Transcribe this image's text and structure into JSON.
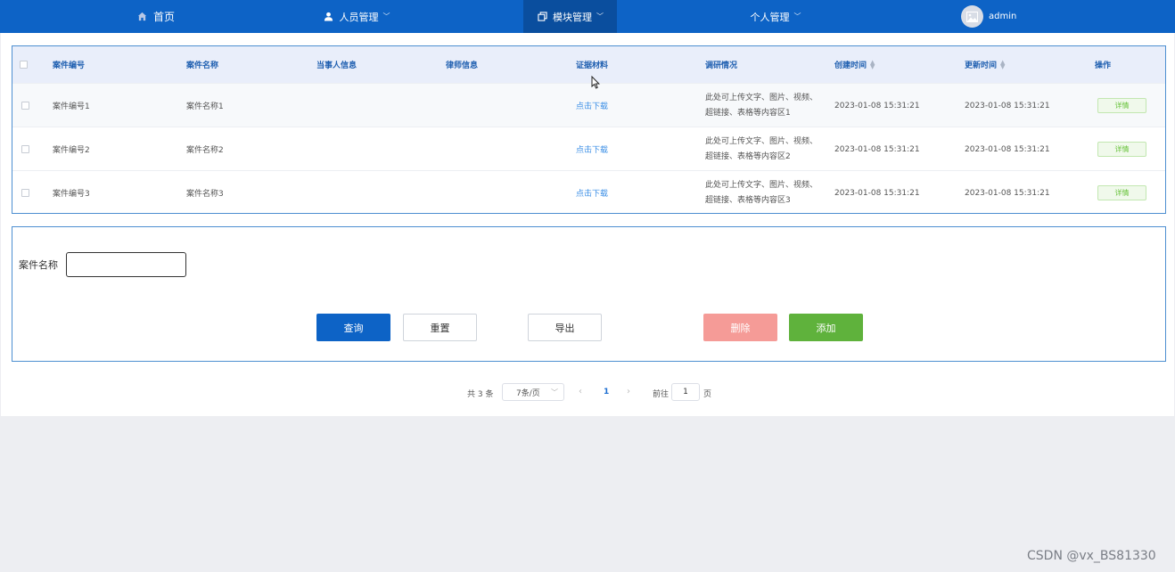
{
  "nav": {
    "home": "首页",
    "staff": "人员管理",
    "module": "模块管理",
    "personal": "个人管理",
    "user": "admin",
    "accent": "#0d63c6"
  },
  "table": {
    "headers": {
      "case_no": "案件编号",
      "case_name": "案件名称",
      "party": "当事人信息",
      "lawyer": "律师信息",
      "evidence": "证据材料",
      "research": "调研情况",
      "created": "创建时间",
      "updated": "更新时间",
      "ops": "操作"
    },
    "rows": [
      {
        "case_no": "案件编号1",
        "case_name": "案件名称1",
        "party": "",
        "lawyer": "",
        "evidence": "点击下载",
        "research": "此处可上传文字、图片、视频、超链接、表格等内容区1",
        "created": "2023-01-08 15:31:21",
        "updated": "2023-01-08 15:31:21",
        "action": "详情"
      },
      {
        "case_no": "案件编号2",
        "case_name": "案件名称2",
        "party": "",
        "lawyer": "",
        "evidence": "点击下载",
        "research": "此处可上传文字、图片、视频、超链接、表格等内容区2",
        "created": "2023-01-08 15:31:21",
        "updated": "2023-01-08 15:31:21",
        "action": "详情"
      },
      {
        "case_no": "案件编号3",
        "case_name": "案件名称3",
        "party": "",
        "lawyer": "",
        "evidence": "点击下载",
        "research": "此处可上传文字、图片、视频、超链接、表格等内容区3",
        "created": "2023-01-08 15:31:21",
        "updated": "2023-01-08 15:31:21",
        "action": "详情"
      }
    ]
  },
  "search": {
    "label": "案件名称",
    "value": "",
    "query": "查询",
    "reset": "重置",
    "export": "导出",
    "delete": "删除",
    "add": "添加"
  },
  "pagination": {
    "total": "共 3 条",
    "page_size": "7条/页",
    "current_page": "1",
    "goto_label": "前往",
    "goto_value": "1",
    "page_unit": "页"
  },
  "watermark": "CSDN @vx_BS81330"
}
